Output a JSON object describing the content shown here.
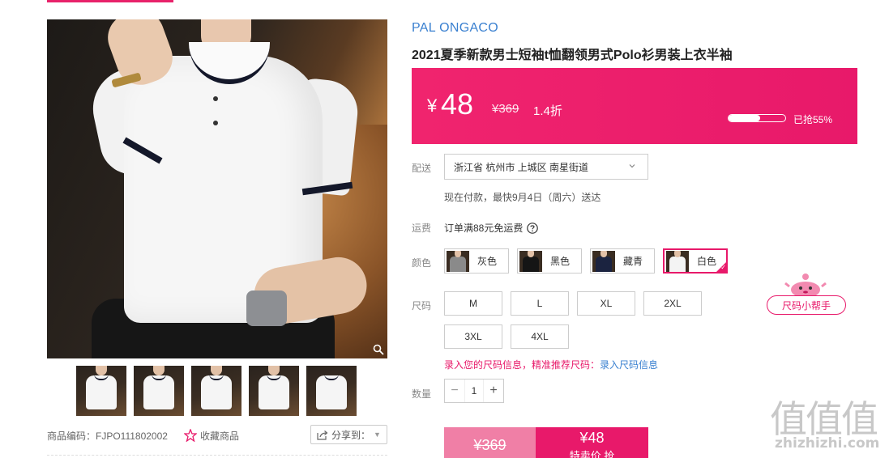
{
  "product": {
    "brand": "PAL ONGACO",
    "title": "2021夏季新款男士短袖t恤翻领男式Polo衫男装上衣半袖",
    "sku_label": "商品编码：FJPO111802002",
    "favorite_label": "收藏商品",
    "share_label": "分享到："
  },
  "price": {
    "currency": "¥",
    "current": "48",
    "original": "¥369",
    "discount": "1.4折",
    "sold_percent": 55,
    "sold_label": "已抢55%"
  },
  "delivery": {
    "label": "配送",
    "address": "浙江省 杭州市 上城区 南星街道",
    "note": "现在付款，最快9月4日（周六）送达"
  },
  "shipping": {
    "label": "运费",
    "text": "订单满88元免运费"
  },
  "colors": {
    "label": "颜色",
    "options": [
      {
        "name": "灰色",
        "swatch": "#8a8a8a",
        "selected": false
      },
      {
        "name": "黑色",
        "swatch": "#151515",
        "selected": false
      },
      {
        "name": "藏青",
        "swatch": "#1b2340",
        "selected": false
      },
      {
        "name": "白色",
        "swatch": "#f4f4f4",
        "selected": true
      }
    ]
  },
  "sizes": {
    "label": "尺码",
    "options": [
      "M",
      "L",
      "XL",
      "2XL",
      "3XL",
      "4XL"
    ],
    "helper_label": "尺码小帮手",
    "tip_prefix": "录入您的尺码信息，精准推荐尺码：",
    "tip_link": "录入尺码信息"
  },
  "quantity": {
    "label": "数量",
    "value": "1",
    "minus": "−",
    "plus": "+"
  },
  "buy": {
    "original_price": "¥369",
    "sale_price": "¥48",
    "sale_label": "特卖价 抢"
  },
  "watermark": {
    "logo": "值值值",
    "site": "zhizhizhi.com"
  },
  "theme": {
    "accent": "#e8196a",
    "link": "#3a80d0"
  }
}
